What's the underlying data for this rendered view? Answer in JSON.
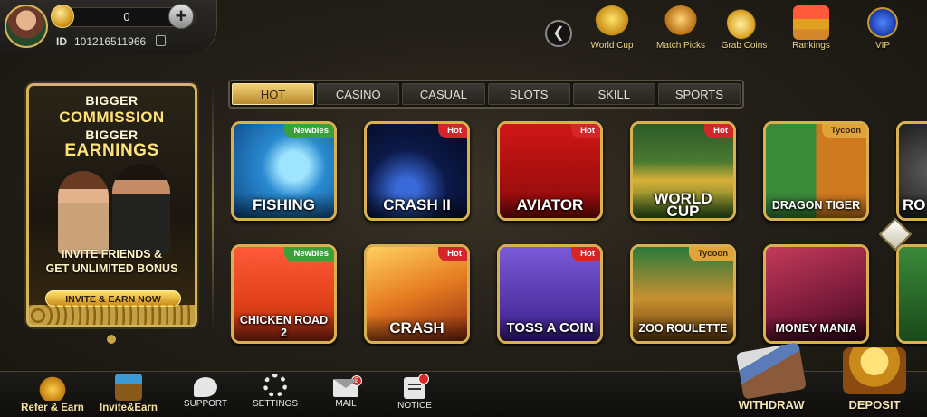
{
  "user": {
    "balance": "0",
    "id_label": "ID",
    "id_value": "101216511966"
  },
  "top_nav": [
    {
      "label": "World Cup",
      "icon": "world-cup-trophy-icon"
    },
    {
      "label": "Match Picks",
      "icon": "match-picks-trophy-icon"
    },
    {
      "label": "Grab Coins",
      "icon": "grab-coins-icon"
    },
    {
      "label": "Rankings",
      "icon": "rankings-podium-icon"
    },
    {
      "label": "VIP",
      "icon": "vip-badge-icon"
    }
  ],
  "promo": {
    "line1": "BIGGER",
    "line2": "COMMISSION",
    "line3": "BIGGER",
    "line4": "EARNINGS",
    "cta_line1": "INVITE FRIENDS &",
    "cta_line2": "GET UNLIMITED BONUS",
    "button": "INVITE & EARN NOW"
  },
  "tabs": [
    {
      "label": "HOT",
      "active": true
    },
    {
      "label": "CASINO",
      "active": false
    },
    {
      "label": "CASUAL",
      "active": false
    },
    {
      "label": "SLOTS",
      "active": false
    },
    {
      "label": "SKILL",
      "active": false
    },
    {
      "label": "SPORTS",
      "active": false
    }
  ],
  "games": [
    {
      "title": "FISHING",
      "badge": "Newbies"
    },
    {
      "title": "CRASH II",
      "badge": "Hot"
    },
    {
      "title": "AVIATOR",
      "badge": "Hot"
    },
    {
      "title": "WORLD CUP",
      "badge": "Hot"
    },
    {
      "title": "DRAGON TIGER",
      "badge": "Tycoon"
    },
    {
      "title": "RO",
      "badge": ""
    },
    {
      "title": "CHICKEN ROAD 2",
      "badge": "Newbies"
    },
    {
      "title": "CRASH",
      "badge": "Hot"
    },
    {
      "title": "TOSS A COIN",
      "badge": "Hot"
    },
    {
      "title": "ZOO ROULETTE",
      "badge": "Tycoon"
    },
    {
      "title": "MONEY MANIA",
      "badge": ""
    },
    {
      "title": "",
      "badge": ""
    }
  ],
  "bottom_nav": [
    {
      "label": "Refer & Earn",
      "icon": "refer-gift-icon"
    },
    {
      "label": "Invite&Earn",
      "icon": "invite-chest-icon"
    },
    {
      "label": "SUPPORT",
      "icon": "support-chat-icon"
    },
    {
      "label": "SETTINGS",
      "icon": "settings-gear-icon"
    },
    {
      "label": "MAIL",
      "icon": "mail-icon",
      "count": "2"
    },
    {
      "label": "NOTICE",
      "icon": "notice-icon"
    }
  ],
  "actions": {
    "withdraw": "WITHDRAW",
    "deposit": "DEPOSIT"
  },
  "colors": {
    "gold": "#d9b04f",
    "tab_active": "#f1d079",
    "hot_badge": "#d4262a",
    "newbies_badge": "#3aa03a",
    "tycoon_badge": "#e0a43a"
  }
}
